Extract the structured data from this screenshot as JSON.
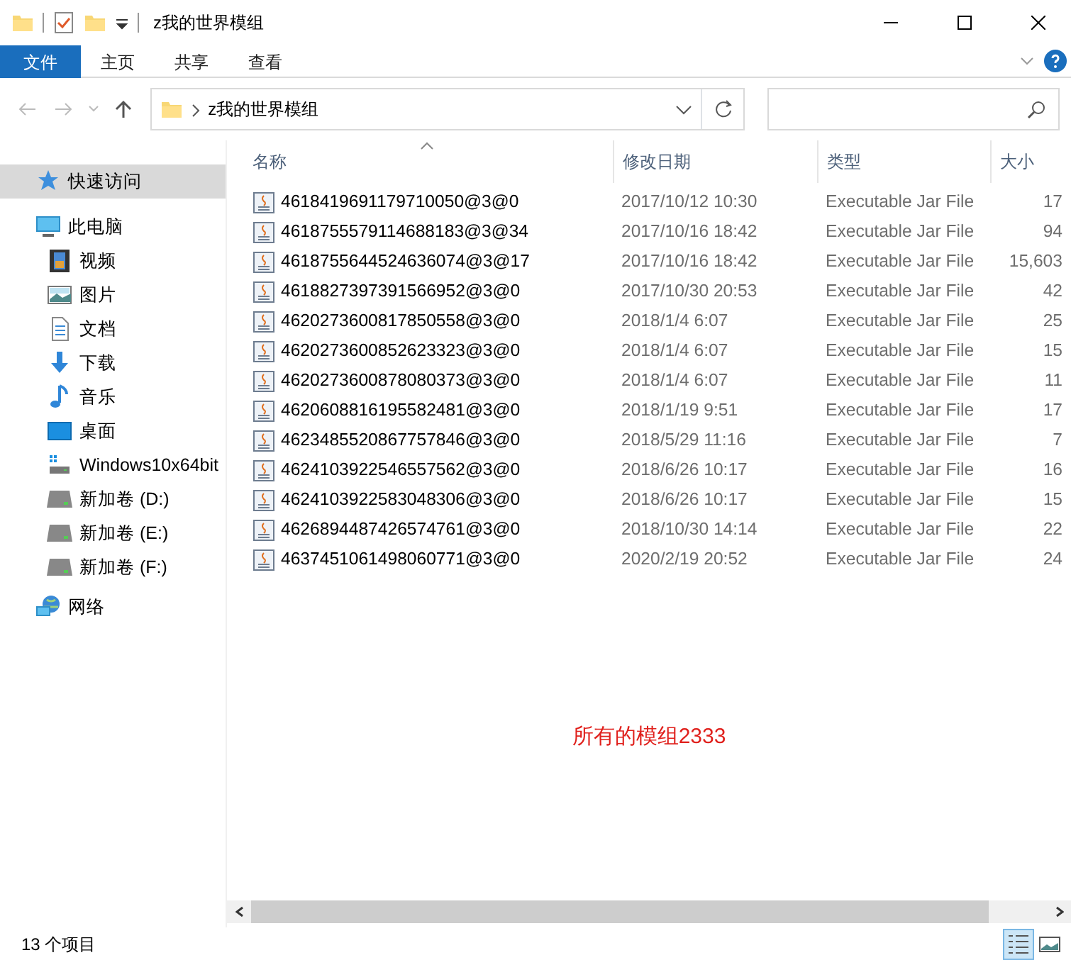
{
  "window": {
    "title": "z我的世界模组"
  },
  "ribbon": {
    "tabs": [
      {
        "label": "文件",
        "selected": true
      },
      {
        "label": "主页",
        "selected": false
      },
      {
        "label": "共享",
        "selected": false
      },
      {
        "label": "查看",
        "selected": false
      }
    ]
  },
  "address": {
    "path": "z我的世界模组"
  },
  "sidebar": {
    "items": [
      {
        "label": "快速访问",
        "kind": "star",
        "selected": true
      },
      {
        "label": "此电脑",
        "kind": "pc",
        "selected": false,
        "children": [
          {
            "label": "视频",
            "kind": "video",
            "selected": false
          },
          {
            "label": "图片",
            "kind": "image",
            "selected": false
          },
          {
            "label": "文档",
            "kind": "doc",
            "selected": false
          },
          {
            "label": "下载",
            "kind": "download",
            "selected": false
          },
          {
            "label": "音乐",
            "kind": "music",
            "selected": false
          },
          {
            "label": "桌面",
            "kind": "desktop",
            "selected": false
          },
          {
            "label": "Windows10x64bit",
            "kind": "sysdrive",
            "selected": false
          },
          {
            "label": "新加卷 (D:)",
            "kind": "drive",
            "selected": false
          },
          {
            "label": "新加卷 (E:)",
            "kind": "drive",
            "selected": false
          },
          {
            "label": "新加卷 (F:)",
            "kind": "drive",
            "selected": false
          }
        ]
      },
      {
        "label": "网络",
        "kind": "network",
        "selected": false
      }
    ]
  },
  "table": {
    "columns": [
      {
        "label": "名称",
        "sorted": true
      },
      {
        "label": "修改日期",
        "sorted": false
      },
      {
        "label": "类型",
        "sorted": false
      },
      {
        "label": "大小",
        "sorted": false
      }
    ],
    "rows": [
      {
        "name": "4618419691179710050@3@0",
        "date": "2017/10/12 10:30",
        "type": "Executable Jar File",
        "size": "17"
      },
      {
        "name": "4618755579114688183@3@34",
        "date": "2017/10/16 18:42",
        "type": "Executable Jar File",
        "size": "94"
      },
      {
        "name": "4618755644524636074@3@17",
        "date": "2017/10/16 18:42",
        "type": "Executable Jar File",
        "size": "15,603"
      },
      {
        "name": "4618827397391566952@3@0",
        "date": "2017/10/30 20:53",
        "type": "Executable Jar File",
        "size": "42"
      },
      {
        "name": "4620273600817850558@3@0",
        "date": "2018/1/4 6:07",
        "type": "Executable Jar File",
        "size": "25"
      },
      {
        "name": "4620273600852623323@3@0",
        "date": "2018/1/4 6:07",
        "type": "Executable Jar File",
        "size": "15"
      },
      {
        "name": "4620273600878080373@3@0",
        "date": "2018/1/4 6:07",
        "type": "Executable Jar File",
        "size": "11"
      },
      {
        "name": "4620608816195582481@3@0",
        "date": "2018/1/19 9:51",
        "type": "Executable Jar File",
        "size": "17"
      },
      {
        "name": "4623485520867757846@3@0",
        "date": "2018/5/29 11:16",
        "type": "Executable Jar File",
        "size": "7"
      },
      {
        "name": "4624103922546557562@3@0",
        "date": "2018/6/26 10:17",
        "type": "Executable Jar File",
        "size": "16"
      },
      {
        "name": "4624103922583048306@3@0",
        "date": "2018/6/26 10:17",
        "type": "Executable Jar File",
        "size": "15"
      },
      {
        "name": "4626894487426574761@3@0",
        "date": "2018/10/30 14:14",
        "type": "Executable Jar File",
        "size": "22"
      },
      {
        "name": "4637451061498060771@3@0",
        "date": "2020/2/19 20:52",
        "type": "Executable Jar File",
        "size": "24"
      }
    ]
  },
  "annotation": "所有的模组2333",
  "status_bar": {
    "count": "13 个项目",
    "views": [
      {
        "kind": "details",
        "selected": true
      },
      {
        "kind": "thumbnails",
        "selected": false
      }
    ]
  }
}
